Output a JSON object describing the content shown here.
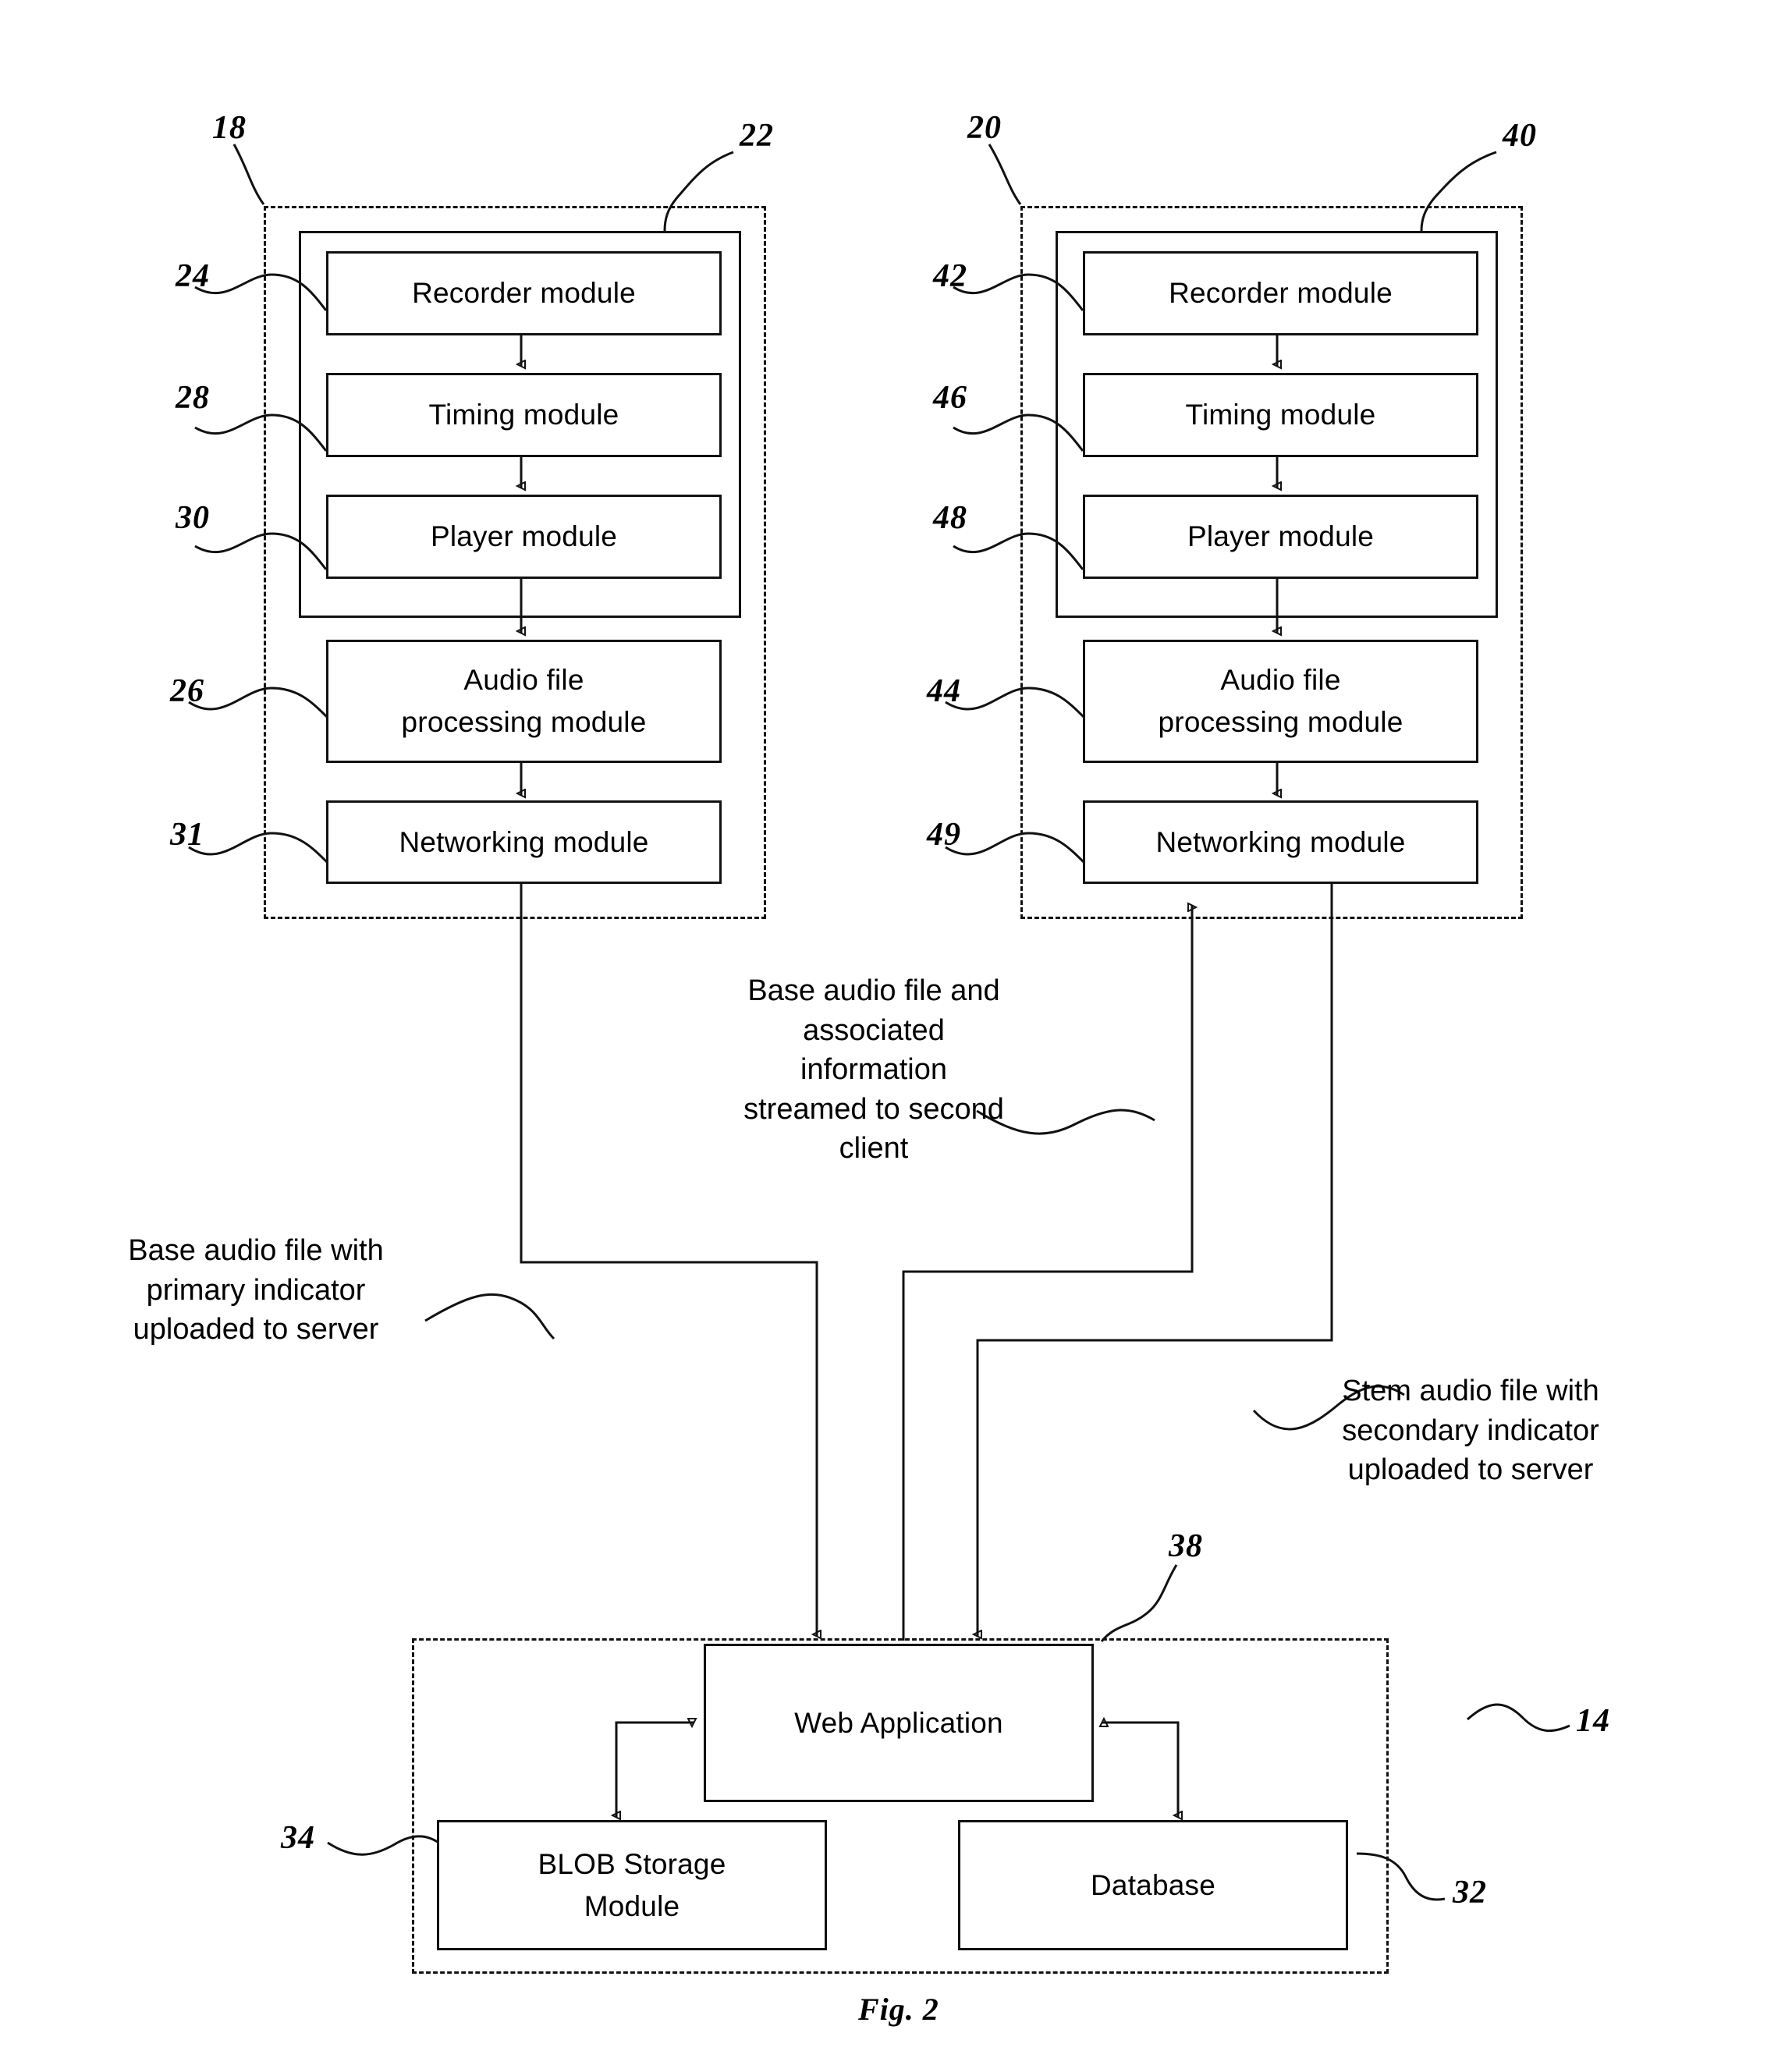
{
  "figure": {
    "caption": "Fig. 2"
  },
  "first_client": {
    "ref_outer": "18",
    "ref_inner": "22",
    "modules": [
      {
        "ref": "24",
        "label": "Recorder module"
      },
      {
        "ref": "28",
        "label": "Timing module"
      },
      {
        "ref": "30",
        "label": "Player module"
      },
      {
        "ref": "26",
        "label": "Audio file\nprocessing module",
        "line1": "Audio file",
        "line2": "processing module"
      },
      {
        "ref": "31",
        "label": "Networking module"
      }
    ]
  },
  "second_client": {
    "ref_outer": "20",
    "ref_inner": "40",
    "modules": [
      {
        "ref": "42",
        "label": "Recorder module"
      },
      {
        "ref": "46",
        "label": "Timing module"
      },
      {
        "ref": "48",
        "label": "Player module"
      },
      {
        "ref": "44",
        "label": "Audio file\nprocessing module",
        "line1": "Audio file",
        "line2": "processing module"
      },
      {
        "ref": "49",
        "label": "Networking module"
      }
    ]
  },
  "server": {
    "ref_outer": "14",
    "ref_web_app": "38",
    "ref_blob": "34",
    "ref_database": "32",
    "web_application": "Web Application",
    "blob_storage_line1": "BLOB Storage",
    "blob_storage_line2": "Module",
    "database": "Database"
  },
  "annotations": {
    "upload_base": {
      "line1": "Base audio file with",
      "line2": "primary indicator",
      "line3": "uploaded to server"
    },
    "stream_to_second": {
      "line1": "Base audio file and",
      "line2": "associated",
      "line3": "information",
      "line4": "streamed to second",
      "line5": "client"
    },
    "upload_stem": {
      "line1": "Stem audio file with",
      "line2": "secondary indicator",
      "line3": "uploaded to server"
    }
  }
}
